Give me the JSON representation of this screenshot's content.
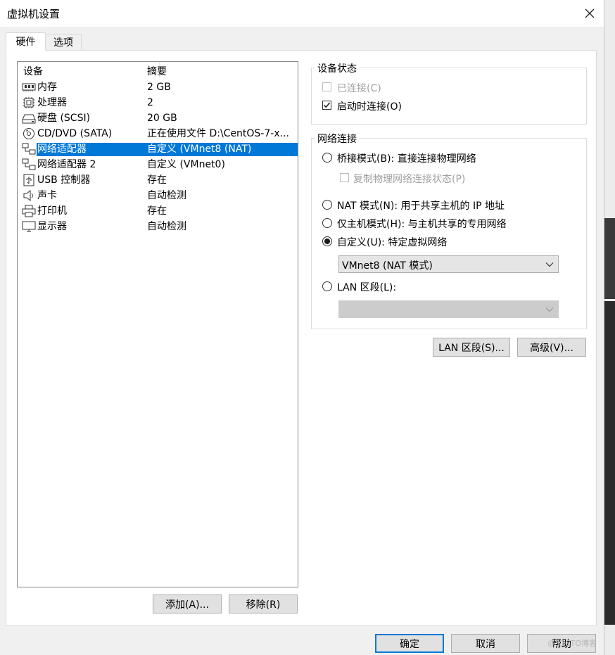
{
  "window": {
    "title": "虚拟机设置"
  },
  "tabs": [
    {
      "label": "硬件",
      "active": true
    },
    {
      "label": "选项",
      "active": false
    }
  ],
  "device_list": {
    "columns": [
      "设备",
      "摘要"
    ],
    "rows": [
      {
        "icon": "memory-icon",
        "device": "内存",
        "summary": "2 GB"
      },
      {
        "icon": "processor-icon",
        "device": "处理器",
        "summary": "2"
      },
      {
        "icon": "hard-disk-icon",
        "device": "硬盘 (SCSI)",
        "summary": "20 GB"
      },
      {
        "icon": "cd-dvd-icon",
        "device": "CD/DVD (SATA)",
        "summary": "正在使用文件 D:\\CentOS-7-x..."
      },
      {
        "icon": "network-adapter-icon",
        "device": "网络适配器",
        "summary": "自定义 (VMnet8 (NAT)",
        "selected": true
      },
      {
        "icon": "network-adapter-icon",
        "device": "网络适配器 2",
        "summary": "自定义 (VMnet0)"
      },
      {
        "icon": "usb-icon",
        "device": "USB 控制器",
        "summary": "存在"
      },
      {
        "icon": "sound-card-icon",
        "device": "声卡",
        "summary": "自动检测"
      },
      {
        "icon": "printer-icon",
        "device": "打印机",
        "summary": "存在"
      },
      {
        "icon": "display-icon",
        "device": "显示器",
        "summary": "自动检测"
      }
    ]
  },
  "list_buttons": {
    "add": "添加(A)...",
    "remove": "移除(R)"
  },
  "device_status": {
    "title": "设备状态",
    "connected": {
      "label": "已连接(C)",
      "checked": false,
      "disabled": true
    },
    "connect_at_power_on": {
      "label": "启动时连接(O)",
      "checked": true
    }
  },
  "network_connection": {
    "title": "网络连接",
    "bridged": {
      "label": "桥接模式(B): 直接连接物理网络",
      "selected": false
    },
    "replicate": {
      "label": "复制物理网络连接状态(P)",
      "checked": false,
      "disabled": true
    },
    "nat": {
      "label": "NAT 模式(N): 用于共享主机的 IP 地址",
      "selected": false
    },
    "host_only": {
      "label": "仅主机模式(H): 与主机共享的专用网络",
      "selected": false
    },
    "custom": {
      "label": "自定义(U): 特定虚拟网络",
      "selected": true
    },
    "custom_network_value": "VMnet8 (NAT 模式)",
    "lan_segment": {
      "label": "LAN 区段(L):",
      "selected": false
    },
    "lan_segment_value": ""
  },
  "net_buttons": {
    "lan_segments": "LAN 区段(S)...",
    "advanced": "高级(V)..."
  },
  "dialog_buttons": {
    "ok": "确定",
    "cancel": "取消",
    "help": "帮助"
  },
  "watermark": "@51CTO博客",
  "colors": {
    "selection": "#0078d7",
    "default_button_border": "#0078d7"
  }
}
